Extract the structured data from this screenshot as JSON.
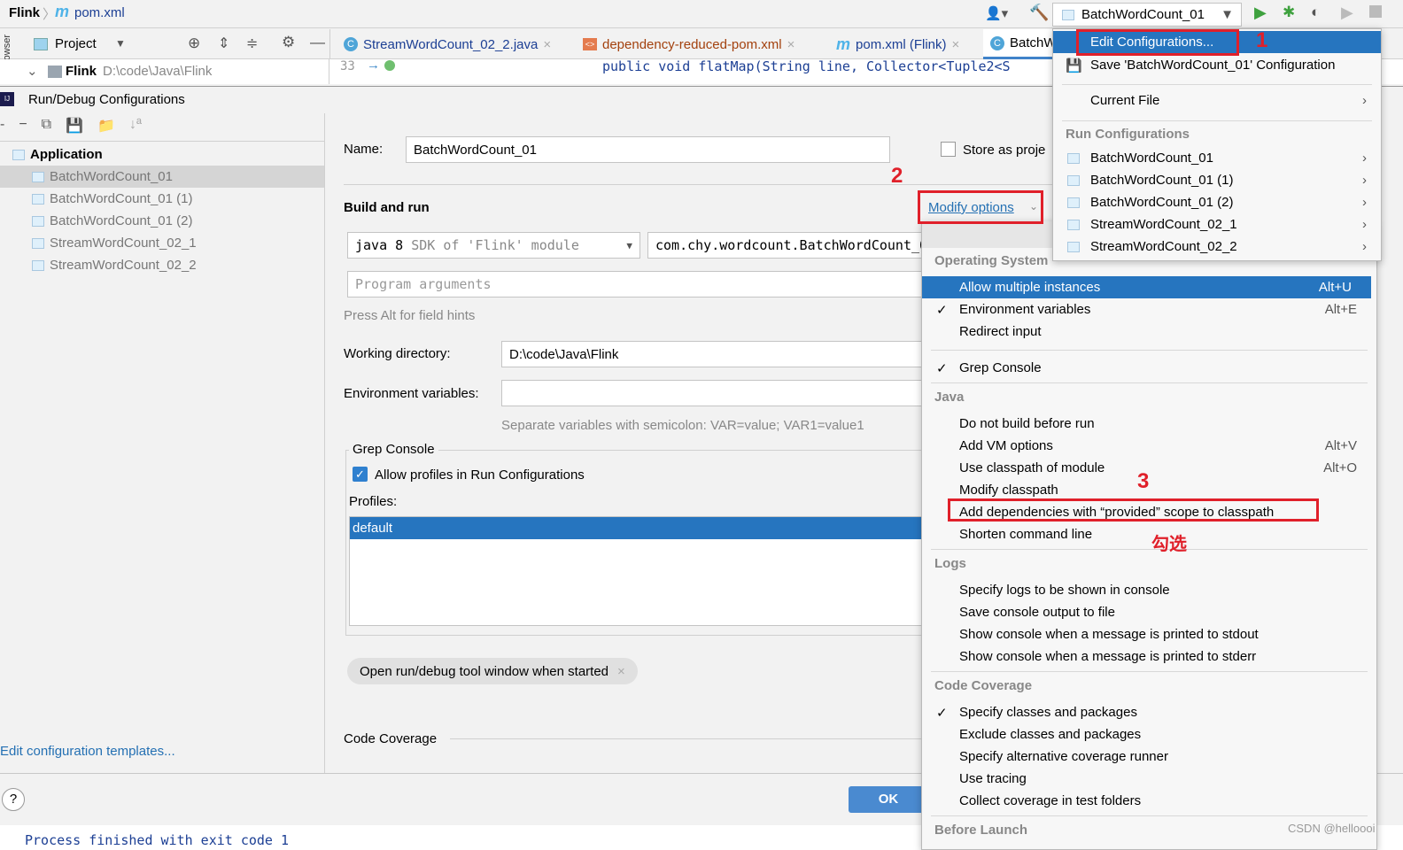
{
  "breadcrumb": {
    "project": "Flink",
    "file": "pom.xml"
  },
  "run_selector": {
    "value": "BatchWordCount_01"
  },
  "project_panel": {
    "title": "Project",
    "root_name": "Flink",
    "root_path": "D:\\code\\Java\\Flink",
    "side_label": "Browser"
  },
  "editor_tabs": [
    {
      "label": "StreamWordCount_02_2.java"
    },
    {
      "label": "dependency-reduced-pom.xml"
    },
    {
      "label": "pom.xml (Flink)"
    },
    {
      "label": "BatchW"
    }
  ],
  "editor": {
    "line_number": "33",
    "code": "public void flatMap(String line, Collector<Tuple2<S"
  },
  "dialog": {
    "title": "Run/Debug Configurations",
    "tree": {
      "group": "Application",
      "items": [
        "BatchWordCount_01",
        "BatchWordCount_01 (1)",
        "BatchWordCount_01 (2)",
        "StreamWordCount_02_1",
        "StreamWordCount_02_2"
      ]
    },
    "edit_templates": "Edit configuration templates...",
    "name_label": "Name:",
    "name_value": "BatchWordCount_01",
    "store_label": "Store as proje",
    "build_run": "Build and run",
    "modify_options": "Modify options",
    "sdk": "java 8",
    "sdk_hint": "SDK of 'Flink' module",
    "main_class": "com.chy.wordcount.BatchWordCount_0",
    "program_args_placeholder": "Program arguments",
    "field_hint": "Press Alt for field hints",
    "workdir_label": "Working directory:",
    "workdir_value": "D:\\code\\Java\\Flink",
    "env_label": "Environment variables:",
    "env_hint": "Separate variables with semicolon: VAR=value; VAR1=value1",
    "grep_title": "Grep Console",
    "grep_allow": "Allow profiles in Run Configurations",
    "grep_allow_checked": true,
    "profiles_label": "Profiles:",
    "profiles": [
      "default"
    ],
    "chip": "Open run/debug tool window when started",
    "code_coverage": "Code Coverage",
    "ok": "OK",
    "help": "?"
  },
  "console": "Process finished with exit code 1",
  "run_menu": {
    "edit": "Edit Configurations...",
    "save": "Save 'BatchWordCount_01' Configuration",
    "current_file": "Current File",
    "header": "Run Configurations",
    "items": [
      "BatchWordCount_01",
      "BatchWordCount_01 (1)",
      "BatchWordCount_01 (2)",
      "StreamWordCount_02_1",
      "StreamWordCount_02_2"
    ]
  },
  "modify_menu": {
    "sections": [
      {
        "header": "Operating System",
        "items": [
          {
            "label": "Allow multiple instances",
            "shortcut": "Alt+U",
            "selected": true
          },
          {
            "label": "Environment variables",
            "shortcut": "Alt+E",
            "checked": true
          },
          {
            "label": "Redirect input"
          }
        ]
      },
      {
        "header": "",
        "items": [
          {
            "label": "Grep Console",
            "checked": true
          }
        ]
      },
      {
        "header": "Java",
        "items": [
          {
            "label": "Do not build before run"
          },
          {
            "label": "Add VM options",
            "shortcut": "Alt+V"
          },
          {
            "label": "Use classpath of module",
            "shortcut": "Alt+O"
          },
          {
            "label": "Modify classpath"
          },
          {
            "label": "Add dependencies with “provided” scope to classpath"
          },
          {
            "label": "Shorten command line"
          }
        ]
      },
      {
        "header": "Logs",
        "items": [
          {
            "label": "Specify logs to be shown in console"
          },
          {
            "label": "Save console output to file"
          },
          {
            "label": "Show console when a message is printed to stdout"
          },
          {
            "label": "Show console when a message is printed to stderr"
          }
        ]
      },
      {
        "header": "Code Coverage",
        "items": [
          {
            "label": "Specify classes and packages",
            "checked": true
          },
          {
            "label": "Exclude classes and packages"
          },
          {
            "label": "Specify alternative coverage runner"
          },
          {
            "label": "Use tracing"
          },
          {
            "label": "Collect coverage in test folders"
          }
        ]
      },
      {
        "header": "Before Launch",
        "items": []
      }
    ]
  },
  "annotations": {
    "n1": "1",
    "n2": "2",
    "n3": "3",
    "note": "勾选",
    "accent": "#e0202a"
  },
  "watermark": "CSDN @helloooi",
  "colors": {
    "selection": "#2675bf",
    "link": "#2470b3",
    "accent_red": "#e0202a"
  }
}
